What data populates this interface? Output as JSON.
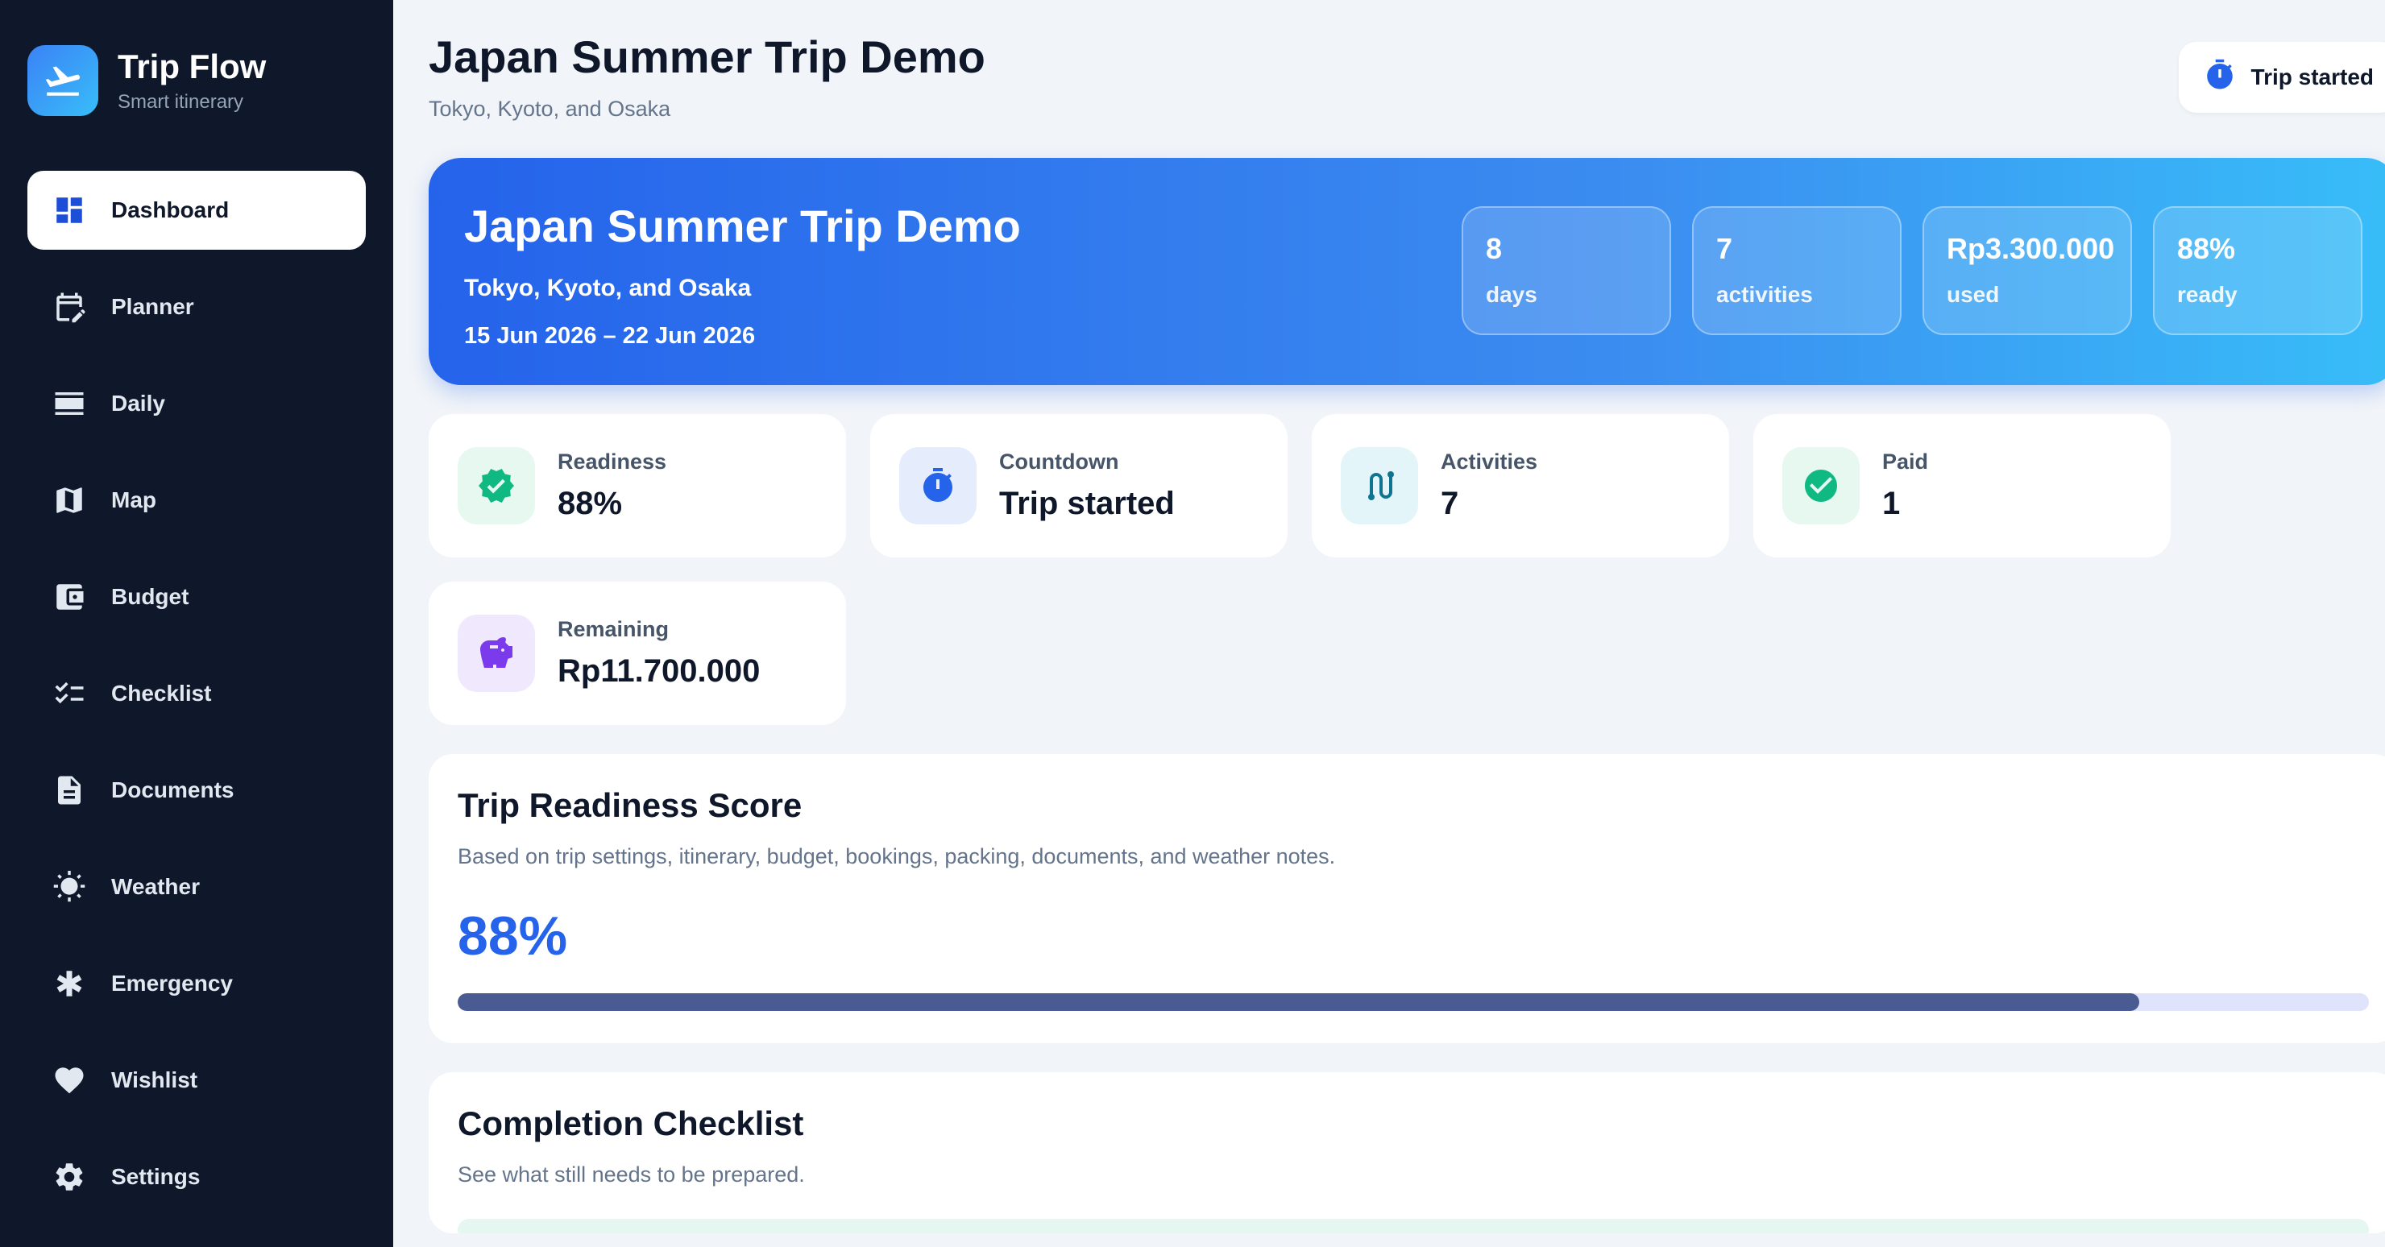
{
  "brand": {
    "title": "Trip Flow",
    "subtitle": "Smart itinerary"
  },
  "nav": [
    {
      "label": "Dashboard",
      "icon": "dashboard-icon",
      "active": true
    },
    {
      "label": "Planner",
      "icon": "calendar-edit-icon"
    },
    {
      "label": "Daily",
      "icon": "daily-list-icon"
    },
    {
      "label": "Map",
      "icon": "map-icon"
    },
    {
      "label": "Budget",
      "icon": "wallet-icon"
    },
    {
      "label": "Checklist",
      "icon": "checklist-icon"
    },
    {
      "label": "Documents",
      "icon": "document-icon"
    },
    {
      "label": "Weather",
      "icon": "sun-icon"
    },
    {
      "label": "Emergency",
      "icon": "asterisk-icon"
    },
    {
      "label": "Wishlist",
      "icon": "heart-icon"
    },
    {
      "label": "Settings",
      "icon": "gear-icon"
    }
  ],
  "header": {
    "title": "Japan Summer Trip Demo",
    "subtitle": "Tokyo, Kyoto, and Osaka",
    "status": "Trip started"
  },
  "hero": {
    "title": "Japan Summer Trip Demo",
    "subtitle": "Tokyo, Kyoto, and Osaka",
    "dates": "15 Jun 2026 – 22 Jun 2026",
    "stats": [
      {
        "value": "8",
        "label": "days"
      },
      {
        "value": "7",
        "label": "activities"
      },
      {
        "value": "Rp3.300.000",
        "label": "used"
      },
      {
        "value": "88%",
        "label": "ready"
      }
    ]
  },
  "cards": [
    {
      "label": "Readiness",
      "value": "88%",
      "icon": "verified-badge-icon",
      "color": "#10b981",
      "bg": "#e7f8f1"
    },
    {
      "label": "Countdown",
      "value": "Trip started",
      "icon": "stopwatch-icon",
      "color": "#2563eb",
      "bg": "#e5edfd"
    },
    {
      "label": "Activities",
      "value": "7",
      "icon": "route-icon",
      "color": "#0e7490",
      "bg": "#e3f5f8"
    },
    {
      "label": "Paid",
      "value": "1",
      "icon": "check-circle-icon",
      "color": "#10b981",
      "bg": "#e7f8f1"
    },
    {
      "label": "Remaining",
      "value": "Rp11.700.000",
      "icon": "piggy-bank-icon",
      "color": "#7c3aed",
      "bg": "#f0e9fd"
    }
  ],
  "readiness": {
    "title": "Trip Readiness Score",
    "subtitle": "Based on trip settings, itinerary, budget, bookings, packing, documents, and weather notes.",
    "score": "88%",
    "progress": 0.88
  },
  "checklist": {
    "title": "Completion Checklist",
    "subtitle": "See what still needs to be prepared."
  },
  "colors": {
    "sidebar": "#0f172a",
    "accent": "#2563eb",
    "progress_fill": "#4a5a92",
    "progress_track": "#dfe3fb"
  }
}
